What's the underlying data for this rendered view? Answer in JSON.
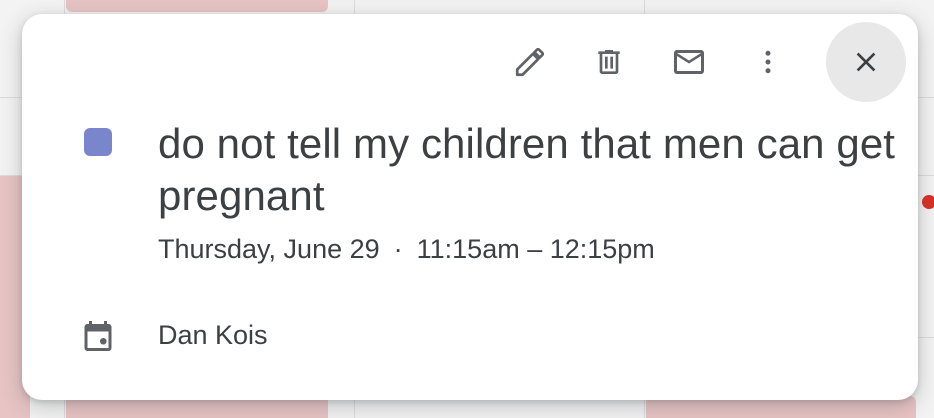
{
  "event": {
    "color": "#7986cb",
    "title": "do not tell my children that men can get pregnant",
    "date": "Thursday, June 29",
    "separator": "·",
    "time": "11:15am – 12:15pm",
    "calendar_owner": "Dan Kois"
  },
  "toolbar": {
    "icons": [
      "pencil-icon",
      "trash-icon",
      "mail-icon",
      "more-vert-icon",
      "close-icon"
    ]
  }
}
